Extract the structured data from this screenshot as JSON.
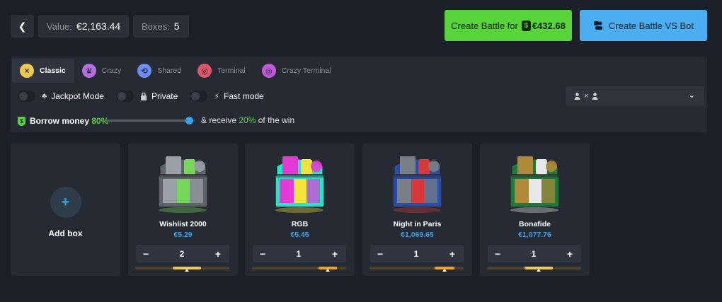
{
  "header": {
    "back_icon": "chevron-left-icon",
    "value_label": "Value:",
    "value": "€2,163.44",
    "boxes_label": "Boxes:",
    "boxes": "5",
    "create_battle_label": "Create Battle for",
    "create_battle_price": "€432.68",
    "bot_label": "Create Battle VS Bot"
  },
  "tabs": [
    {
      "label": "Classic",
      "icon": "swords-icon",
      "color": "#f2c94c",
      "active": true
    },
    {
      "label": "Crazy",
      "icon": "crown-icon",
      "color": "#b46ee0",
      "active": false
    },
    {
      "label": "Shared",
      "icon": "shared-icon",
      "color": "#6c8ef5",
      "active": false
    },
    {
      "label": "Terminal",
      "icon": "target-icon",
      "color": "#e0566a",
      "active": false
    },
    {
      "label": "Crazy Terminal",
      "icon": "crazy-target-icon",
      "color": "#c05ad8",
      "active": false
    }
  ],
  "options": {
    "jackpot": "Jackpot Mode",
    "private": "Private",
    "fast": "Fast mode"
  },
  "players": {
    "separator": "×"
  },
  "borrow": {
    "label": "Borrow money",
    "percent": "80%",
    "receive_prefix": "& receive",
    "receive_percent": "20%",
    "receive_suffix": "of the win",
    "slider_value": 0.94
  },
  "add_box": {
    "label": "Add box"
  },
  "cards": [
    {
      "name": "Wishlist 2000",
      "price": "€5.29",
      "qty": "2",
      "risk_start": 0.4,
      "risk_end": 0.7,
      "risk_color": "#f2c94c",
      "theme": [
        "#9aa0a8",
        "#5f646c",
        "#76d65a"
      ]
    },
    {
      "name": "RGB",
      "price": "€5.45",
      "qty": "1",
      "risk_start": 0.71,
      "risk_end": 0.9,
      "risk_color": "#f2a516",
      "theme": [
        "#e43bd6",
        "#2be0c7",
        "#f2e43a"
      ]
    },
    {
      "name": "Night in Paris",
      "price": "€1,069.65",
      "qty": "1",
      "risk_start": 0.69,
      "risk_end": 0.9,
      "risk_color": "#f2a516",
      "theme": [
        "#7a7f87",
        "#2a4da8",
        "#d9383a"
      ]
    },
    {
      "name": "Bonafide",
      "price": "€1,077.76",
      "qty": "1",
      "risk_start": 0.4,
      "risk_end": 0.7,
      "risk_color": "#f2c94c",
      "theme": [
        "#b08a3a",
        "#1b7a3c",
        "#e8e8e8"
      ]
    }
  ],
  "stepper": {
    "minus": "−",
    "plus": "+"
  }
}
